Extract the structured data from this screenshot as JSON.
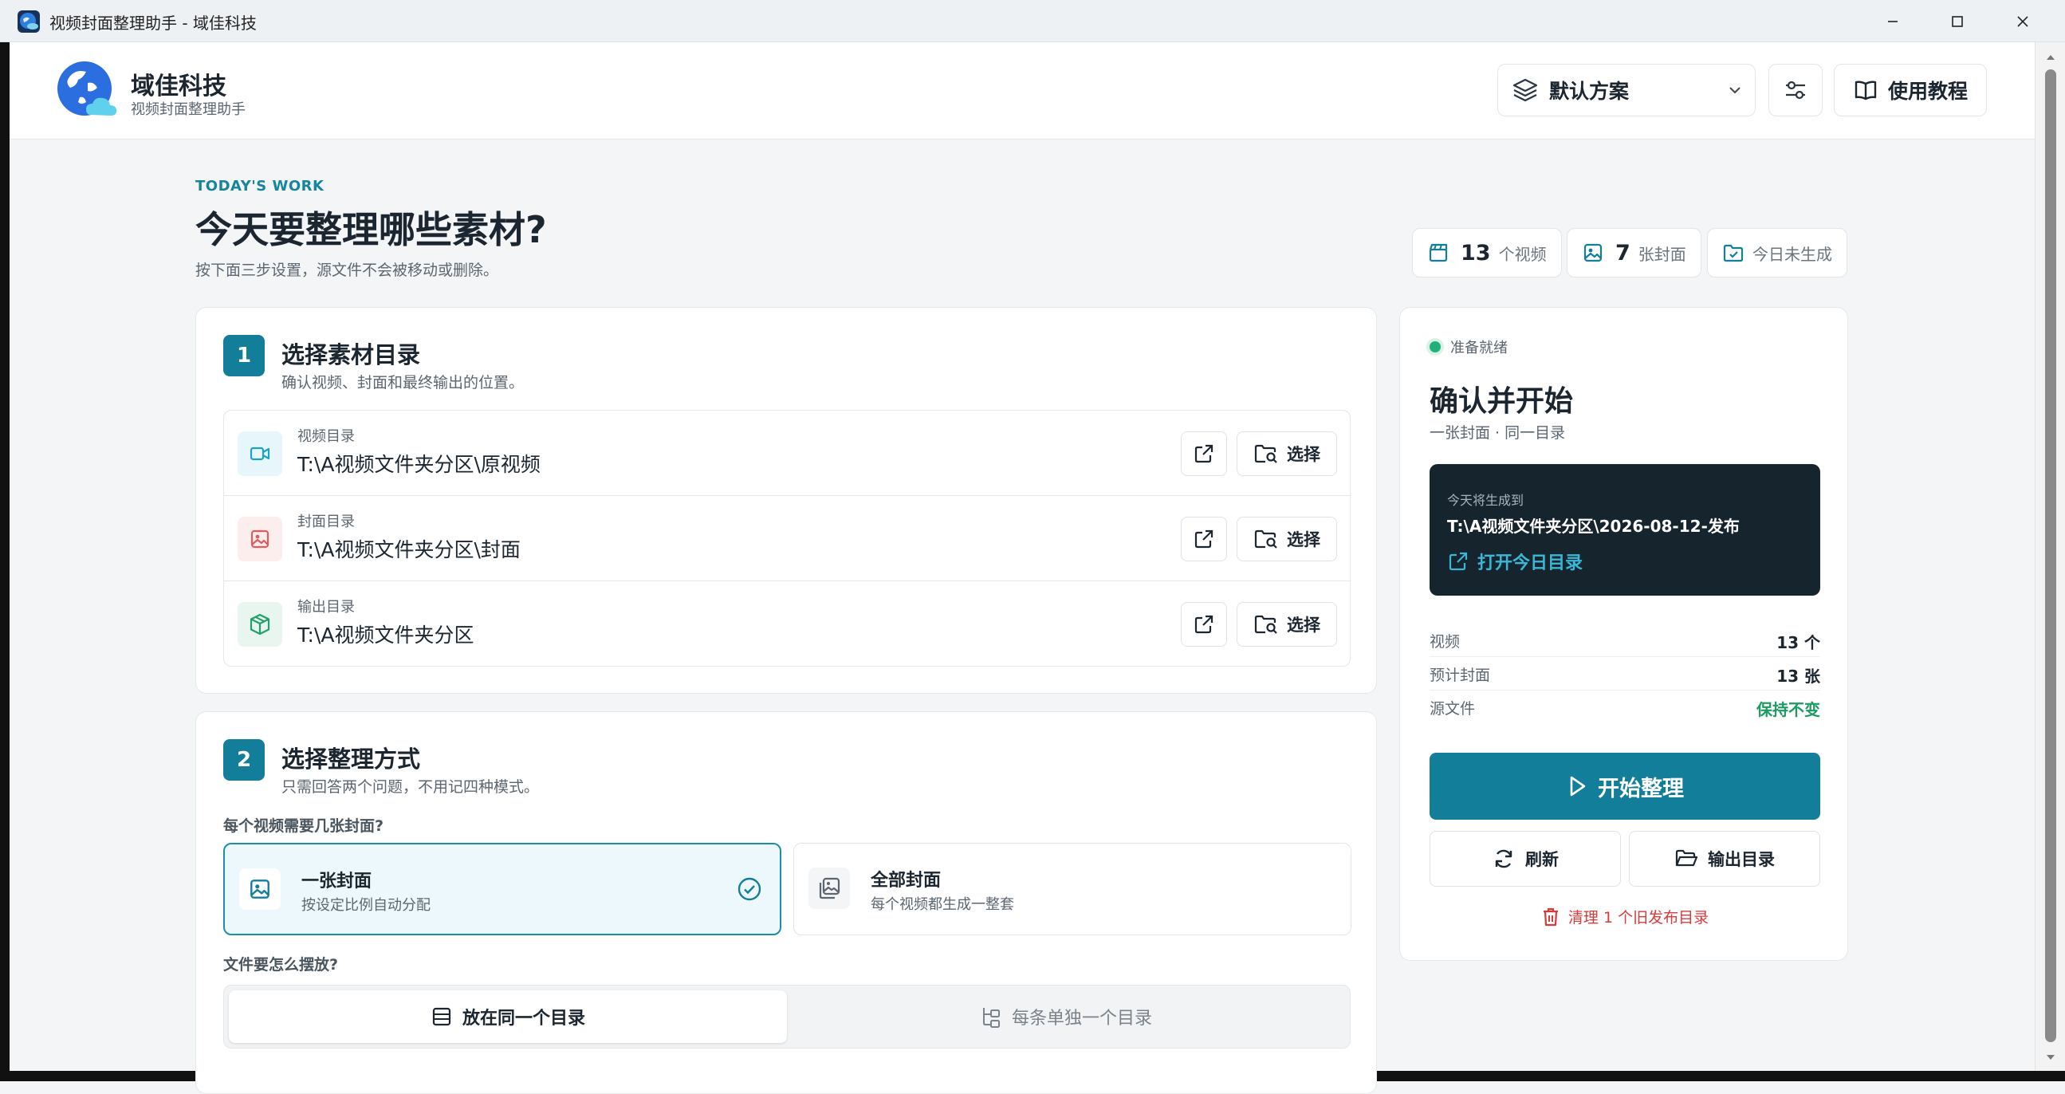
{
  "window": {
    "title": "视频封面整理助手 - 域佳科技",
    "controls": [
      "minimize",
      "maximize",
      "close"
    ]
  },
  "header": {
    "brand_name": "域佳科技",
    "brand_sub": "视频封面整理助手",
    "scheme_label": "默认方案",
    "scheme_icon": "layers-icon",
    "settings_icon": "sliders-icon",
    "tutorial_label": "使用教程",
    "tutorial_icon": "book-icon"
  },
  "intro": {
    "eyebrow": "TODAY'S WORK",
    "title": "今天要整理哪些素材?",
    "subtitle": "按下面三步设置，源文件不会被移动或删除。"
  },
  "stats": [
    {
      "icon": "clapper-icon",
      "value": "13",
      "unit": "个视频"
    },
    {
      "icon": "image-icon",
      "value": "7",
      "unit": "张封面"
    },
    {
      "icon": "folder-check-icon",
      "text": "今日未生成"
    }
  ],
  "step1": {
    "number": "1",
    "title": "选择素材目录",
    "subtitle": "确认视频、封面和最终输出的位置。",
    "choose_label": "选择",
    "dirs": [
      {
        "label": "视频目录",
        "value": "T:\\A视频文件夹分区\\原视频",
        "icon": "video-icon",
        "color": "#1aa3c4"
      },
      {
        "label": "封面目录",
        "value": "T:\\A视频文件夹分区\\封面",
        "icon": "image-icon",
        "color": "#e25b5b"
      },
      {
        "label": "输出目录",
        "value": "T:\\A视频文件夹分区",
        "icon": "box-icon",
        "color": "#22a06b"
      }
    ]
  },
  "step2": {
    "number": "2",
    "title": "选择整理方式",
    "subtitle": "只需回答两个问题，不用记四种模式。",
    "q1": "每个视频需要几张封面?",
    "cover_options": [
      {
        "title": "一张封面",
        "sub": "按设定比例自动分配",
        "selected": true
      },
      {
        "title": "全部封面",
        "sub": "每个视频都生成一整套",
        "selected": false
      }
    ],
    "q2": "文件要怎么摆放?",
    "placement_options": [
      {
        "label": "放在同一个目录",
        "active": true
      },
      {
        "label": "每条单独一个目录",
        "active": false
      }
    ]
  },
  "side": {
    "status": "准备就绪",
    "title": "确认并开始",
    "subtitle": "一张封面 · 同一目录",
    "dest_label": "今天将生成到",
    "dest_path": "T:\\A视频文件夹分区\\2026-08-12-发布",
    "open_today_label": "打开今日目录",
    "summary": [
      {
        "label": "视频",
        "value": "13 个"
      },
      {
        "label": "预计封面",
        "value": "13 张"
      },
      {
        "label": "源文件",
        "value": "保持不变",
        "highlight": true
      }
    ],
    "start_label": "开始整理",
    "refresh_label": "刷新",
    "output_label": "输出目录",
    "cleanup_label": "清理 1 个旧发布目录"
  },
  "colors": {
    "accent": "#127e99",
    "success": "#1c9a62",
    "danger": "#d93a3a",
    "dark_panel": "#16252d"
  }
}
